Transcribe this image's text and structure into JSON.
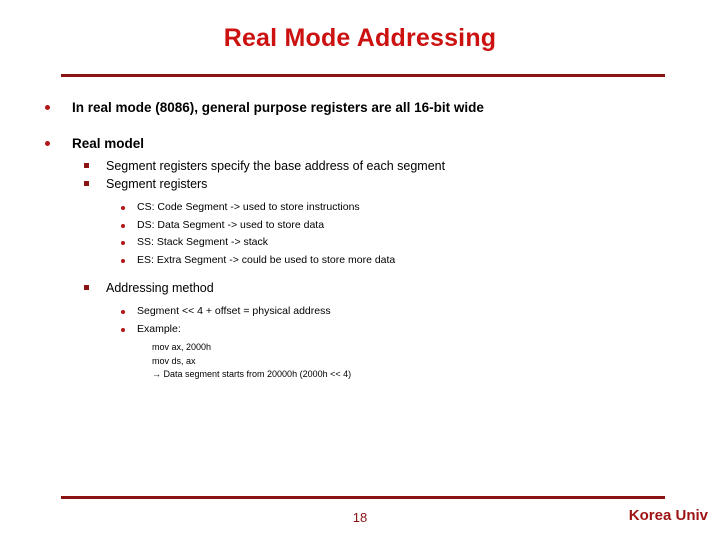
{
  "slide": {
    "title": "Real Mode Addressing",
    "accent_color": "#CC1111",
    "rule_color": "#8B1313",
    "bullet_color": "#B01818",
    "background": "#ffffff"
  },
  "content": {
    "b1": "In real mode (8086), general purpose registers are all 16-bit wide",
    "b2": "Real model",
    "b2_s1": "Segment registers specify the base address of each segment",
    "b2_s2": "Segment registers",
    "b2_s2_i1": "CS: Code Segment -> used to store instructions",
    "b2_s2_i2": "DS: Data Segment -> used to store data",
    "b2_s2_i3": "SS: Stack Segment -> stack",
    "b2_s2_i4": "ES: Extra Segment -> could be used to store more data",
    "b2_s3": "Addressing method",
    "b2_s3_i1": "Segment << 4 + offset = physical address",
    "b2_s3_i2": "Example:",
    "code1": "mov ax, 2000h",
    "code2": "mov ds, ax",
    "code3": "→ Data segment starts from 20000h (2000h << 4)"
  },
  "footer": {
    "page_number": "18",
    "brand": "Korea Univ",
    "page_number_color": "#8B1313",
    "brand_color": "#9E1414"
  }
}
